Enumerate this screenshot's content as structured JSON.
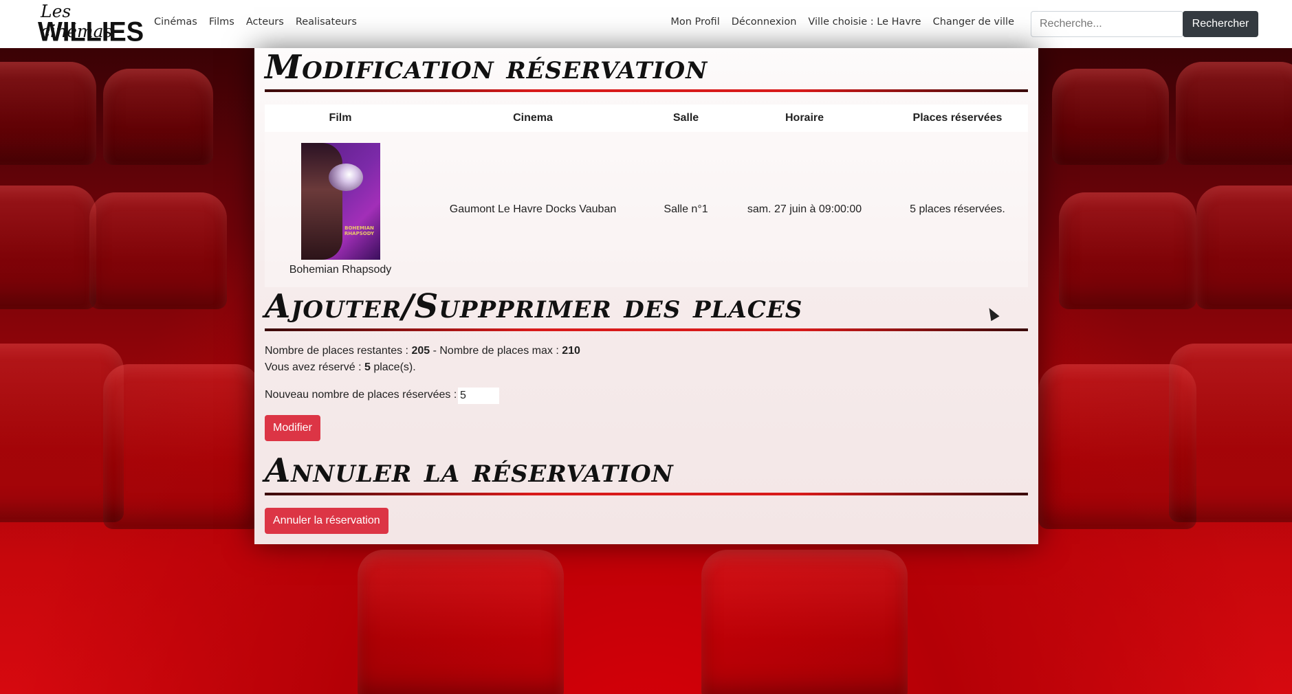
{
  "brand": {
    "line1": "Les cinémas",
    "line2": "WILLIES"
  },
  "nav": {
    "left": [
      "Cinémas",
      "Films",
      "Acteurs",
      "Realisateurs"
    ],
    "right": [
      "Mon Profil",
      "Déconnexion",
      "Ville choisie : Le Havre",
      "Changer de ville"
    ]
  },
  "search": {
    "placeholder": "Recherche...",
    "button": "Rechercher"
  },
  "sections": {
    "modif_title": "Modification réservation",
    "places_title": "Ajouter/Suppprimer des places",
    "cancel_title": "Annuler la réservation"
  },
  "table": {
    "headers": [
      "Film",
      "Cinema",
      "Salle",
      "Horaire",
      "Places réservées"
    ],
    "row": {
      "film": "Bohemian Rhapsody",
      "cinema": "Gaumont Le Havre Docks Vauban",
      "salle": "Salle n°1",
      "horaire": "sam. 27 juin à 09:00:00",
      "places": "5 places réservées."
    }
  },
  "poster": {
    "title": "BOHEMIAN RHAPSODY"
  },
  "places": {
    "restantes_label": "Nombre de places restantes : ",
    "restantes": "205",
    "max_label": " - Nombre de places max : ",
    "max": "210",
    "reserve_label": "Vous avez réservé : ",
    "reserve": "5",
    "reserve_suffix": " place(s).",
    "nouveau_label": "Nouveau nombre de places réservées : ",
    "nouveau_value": "5",
    "modifier_button": "Modifier"
  },
  "cancel": {
    "button": "Annuler la réservation"
  },
  "colors": {
    "accent": "#dc3545",
    "dark": "#343a40",
    "rule": "#d81a1a"
  }
}
